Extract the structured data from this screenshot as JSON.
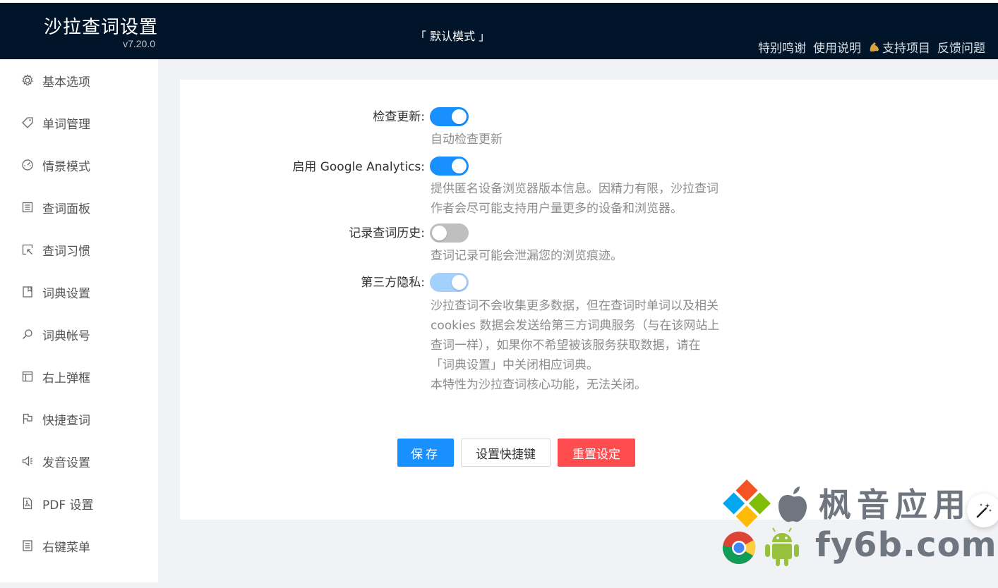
{
  "header": {
    "title": "沙拉查词设置",
    "version": "v7.20.0",
    "mode": "「 默认模式 」",
    "links": [
      "特别鸣谢",
      "使用说明",
      "支持项目",
      "反馈问题"
    ]
  },
  "sidebar": {
    "items": [
      {
        "label": "基本选项",
        "icon": "gear-icon"
      },
      {
        "label": "单词管理",
        "icon": "tag-icon"
      },
      {
        "label": "情景模式",
        "icon": "dashboard-icon"
      },
      {
        "label": "查词面板",
        "icon": "panel-icon"
      },
      {
        "label": "查词习惯",
        "icon": "select-icon"
      },
      {
        "label": "词典设置",
        "icon": "book-icon"
      },
      {
        "label": "词典帐号",
        "icon": "key-icon"
      },
      {
        "label": "右上弹框",
        "icon": "layout-icon"
      },
      {
        "label": "快捷查词",
        "icon": "flag-icon"
      },
      {
        "label": "发音设置",
        "icon": "sound-icon"
      },
      {
        "label": "PDF 设置",
        "icon": "pdf-icon"
      },
      {
        "label": "右键菜单",
        "icon": "menu-icon"
      }
    ]
  },
  "settings": {
    "check_update": {
      "label": "检查更新:",
      "enabled": true,
      "desc": "自动检查更新"
    },
    "analytics": {
      "label": "启用 Google Analytics:",
      "enabled": true,
      "desc": "提供匿名设备浏览器版本信息。因精力有限，沙拉查词作者会尽可能支持用户量更多的设备和浏览器。"
    },
    "history": {
      "label": "记录查词历史:",
      "enabled": false,
      "desc": "查词记录可能会泄漏您的浏览痕迹。"
    },
    "third_party": {
      "label": "第三方隐私:",
      "enabled": true,
      "disabled": true,
      "desc": "沙拉查词不会收集更多数据，但在查词时单词以及相关 cookies 数据会发送给第三方词典服务（与在该网站上查词一样），如果你不希望被该服务获取数据，请在「词典设置」中关闭相应词典。",
      "desc2": "本特性为沙拉查词核心功能，无法关闭。"
    }
  },
  "buttons": {
    "save": "保存",
    "hotkey": "设置快捷键",
    "reset": "重置设定"
  },
  "watermark": {
    "cn": "枫音应用",
    "en": "fy6b.com"
  },
  "colors": {
    "header_bg": "#001529",
    "primary": "#1890ff",
    "danger": "#ff4d4f"
  }
}
